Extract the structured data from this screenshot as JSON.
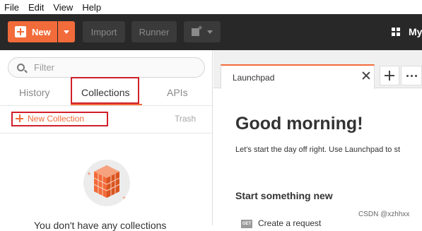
{
  "menu": [
    "File",
    "Edit",
    "View",
    "Help"
  ],
  "toolbar": {
    "new_label": "New",
    "import_label": "Import",
    "runner_label": "Runner",
    "workspace_label": "My"
  },
  "sidebar": {
    "filter_placeholder": "Filter",
    "tabs": [
      "History",
      "Collections",
      "APIs"
    ],
    "active_tab": "Collections",
    "new_collection_label": "New Collection",
    "trash_label": "Trash",
    "empty_text": "You don't have any collections"
  },
  "main": {
    "tab_title": "Launchpad",
    "greeting": "Good morning!",
    "subtext": "Let's start the day off right. Use Launchpad to st",
    "start_heading": "Start something new",
    "create_request_label": "Create a request",
    "get_badge": "GET"
  },
  "colors": {
    "accent": "#f26b3a",
    "toolbar_bg": "#282828",
    "highlight_box": "#d0202a"
  },
  "watermark": "CSDN @xzhhxx"
}
